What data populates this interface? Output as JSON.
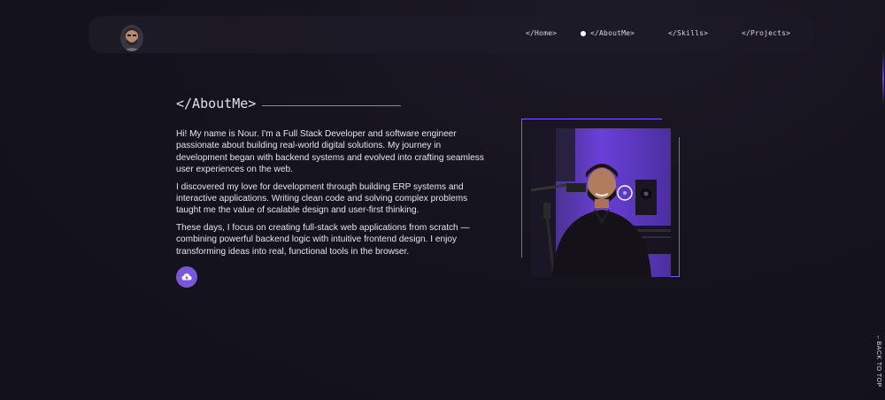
{
  "nav": {
    "links": [
      {
        "label": "</Home>"
      },
      {
        "label": "</AboutMe>"
      },
      {
        "label": "</Skills>"
      },
      {
        "label": "</Projects>"
      }
    ],
    "active_index": 1
  },
  "about": {
    "title": "</AboutMe>",
    "paragraphs": [
      "Hi! My name is Nour. I'm a Full Stack Developer and software engineer passionate about building real-world digital solutions. My journey in development began with backend systems and evolved into crafting seamless user experiences on the web.",
      "I discovered my love for development through building ERP systems and interactive applications. Writing clean code and solving complex problems taught me the value of scalable design and user-first thinking.",
      "These days, I focus on creating full-stack web applications from scratch — combining powerful backend logic with intuitive frontend design. I enjoy transforming ideas into real, functional tools in the browser."
    ],
    "cv_button_icon": "cloud-download-icon"
  },
  "back_to_top": {
    "label": "←BACK TO TOP"
  },
  "colors": {
    "accent": "#7a57d8",
    "frame": "#7b5cff",
    "background": "#14121b"
  }
}
